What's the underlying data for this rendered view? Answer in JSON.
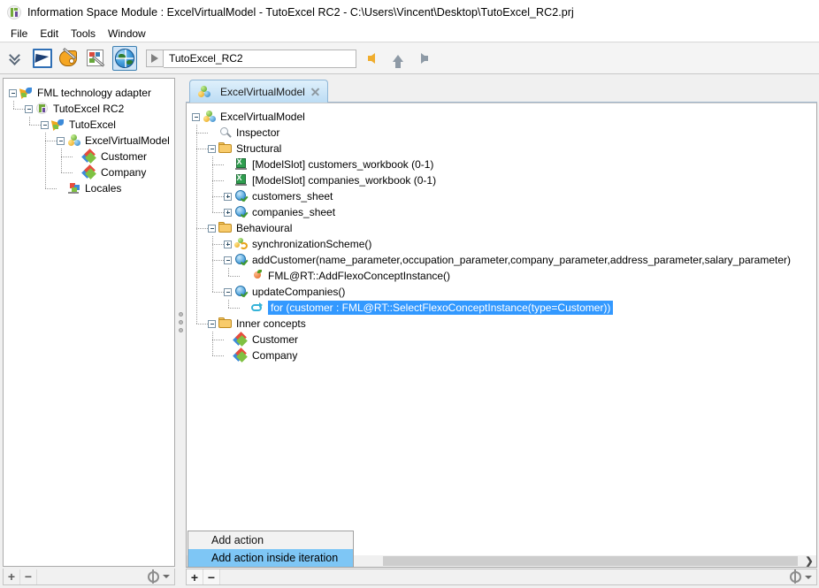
{
  "window": {
    "title": "Information Space Module : ExcelVirtualModel - TutoExcel RC2 - C:\\Users\\Vincent\\Desktop\\TutoExcel_RC2.prj",
    "icon": "project-icon"
  },
  "menubar": {
    "items": [
      {
        "label": "File"
      },
      {
        "label": "Edit"
      },
      {
        "label": "Tools"
      },
      {
        "label": "Window"
      }
    ]
  },
  "toolbar": {
    "buttons": [
      {
        "name": "expand-all-icon",
        "selected": false
      },
      {
        "name": "view-point-icon",
        "selected": false
      },
      {
        "name": "palette-icon",
        "selected": false
      },
      {
        "name": "diagram-editor-icon",
        "selected": false
      },
      {
        "name": "information-space-icon",
        "selected": true
      }
    ],
    "run_button": "run-icon",
    "path_value": "TutoExcel_RC2",
    "nav": [
      {
        "name": "back-arrow-icon"
      },
      {
        "name": "up-arrow-icon"
      },
      {
        "name": "forward-arrow-icon"
      }
    ]
  },
  "sidebar": {
    "nodes": [
      {
        "label": "FML technology adapter",
        "icon": "adapter-icon",
        "depth": 0,
        "expander": "minus"
      },
      {
        "label": "TutoExcel RC2",
        "icon": "project-icon",
        "depth": 1,
        "expander": "minus"
      },
      {
        "label": "TutoExcel",
        "icon": "adapter-icon",
        "depth": 2,
        "expander": "minus"
      },
      {
        "label": "ExcelVirtualModel",
        "icon": "spheres-icon",
        "depth": 3,
        "expander": "minus"
      },
      {
        "label": "Customer",
        "icon": "concept-icon",
        "depth": 4,
        "expander": "none"
      },
      {
        "label": "Company",
        "icon": "concept-icon",
        "depth": 4,
        "expander": "none"
      },
      {
        "label": "Locales",
        "icon": "locales-icon",
        "depth": 3,
        "expander": "none"
      }
    ],
    "footer": {
      "add_label": "+",
      "remove_label": "−",
      "settings_icon": "gear-icon"
    }
  },
  "splitter": {
    "name": "panel-splitter"
  },
  "main": {
    "tabs": [
      {
        "label": "ExcelVirtualModel",
        "icon": "spheres-icon",
        "close": "close-icon",
        "active": true
      }
    ],
    "tree": [
      {
        "label": "ExcelVirtualModel",
        "icon": "spheres-icon",
        "depth": 0,
        "expander": "minus",
        "selected": false
      },
      {
        "label": "Inspector",
        "icon": "magnifier-icon",
        "depth": 1,
        "expander": "none",
        "selected": false
      },
      {
        "label": "Structural",
        "icon": "folder-icon",
        "depth": 1,
        "expander": "minus",
        "selected": false
      },
      {
        "label": "[ModelSlot] customers_workbook (0-1)",
        "icon": "excel-icon",
        "depth": 2,
        "expander": "none",
        "selected": false
      },
      {
        "label": "[ModelSlot] companies_workbook (0-1)",
        "icon": "excel-icon",
        "depth": 2,
        "expander": "none",
        "selected": false
      },
      {
        "label": "customers_sheet",
        "icon": "sheet-icon",
        "depth": 2,
        "expander": "plus",
        "selected": false
      },
      {
        "label": "companies_sheet",
        "icon": "sheet-icon",
        "depth": 2,
        "expander": "plus",
        "selected": false
      },
      {
        "label": "Behavioural",
        "icon": "folder-icon",
        "depth": 1,
        "expander": "minus",
        "selected": false
      },
      {
        "label": "synchronizationScheme()",
        "icon": "sync-icon",
        "depth": 2,
        "expander": "plus",
        "selected": false
      },
      {
        "label": "addCustomer(name_parameter,occupation_parameter,company_parameter,address_parameter,salary_parameter)",
        "icon": "sheet-icon",
        "depth": 2,
        "expander": "minus",
        "selected": false
      },
      {
        "label": "FML@RT::AddFlexoConceptInstance()",
        "icon": "bullet-icon",
        "depth": 3,
        "expander": "none",
        "selected": false
      },
      {
        "label": "updateCompanies()",
        "icon": "sheet-icon",
        "depth": 2,
        "expander": "minus",
        "selected": false
      },
      {
        "label": "for (customer : FML@RT::SelectFlexoConceptInstance(type=Customer))",
        "icon": "loop-icon",
        "depth": 3,
        "expander": "none",
        "selected": true
      },
      {
        "label": "Inner concepts",
        "icon": "folder-icon",
        "depth": 1,
        "expander": "minus",
        "selected": false
      },
      {
        "label": "Customer",
        "icon": "concept-icon",
        "depth": 2,
        "expander": "none",
        "selected": false
      },
      {
        "label": "Company",
        "icon": "concept-icon",
        "depth": 2,
        "expander": "none",
        "selected": false
      }
    ],
    "context_menu": {
      "items": [
        {
          "label": "Add action",
          "highlighted": false
        },
        {
          "label": "Add action inside iteration",
          "highlighted": true
        }
      ]
    },
    "hscrollbar": {
      "name": "horizontal-scrollbar",
      "right_button": "❯"
    },
    "footer": {
      "add_label": "+",
      "remove_label": "−",
      "settings_icon": "gear-icon"
    }
  },
  "colors": {
    "selection_blue": "#3399ff",
    "menu_highlight": "#7ec6f5",
    "tab_active": "#bcdcf4",
    "toolbar_selected": "#cfe4f7"
  }
}
